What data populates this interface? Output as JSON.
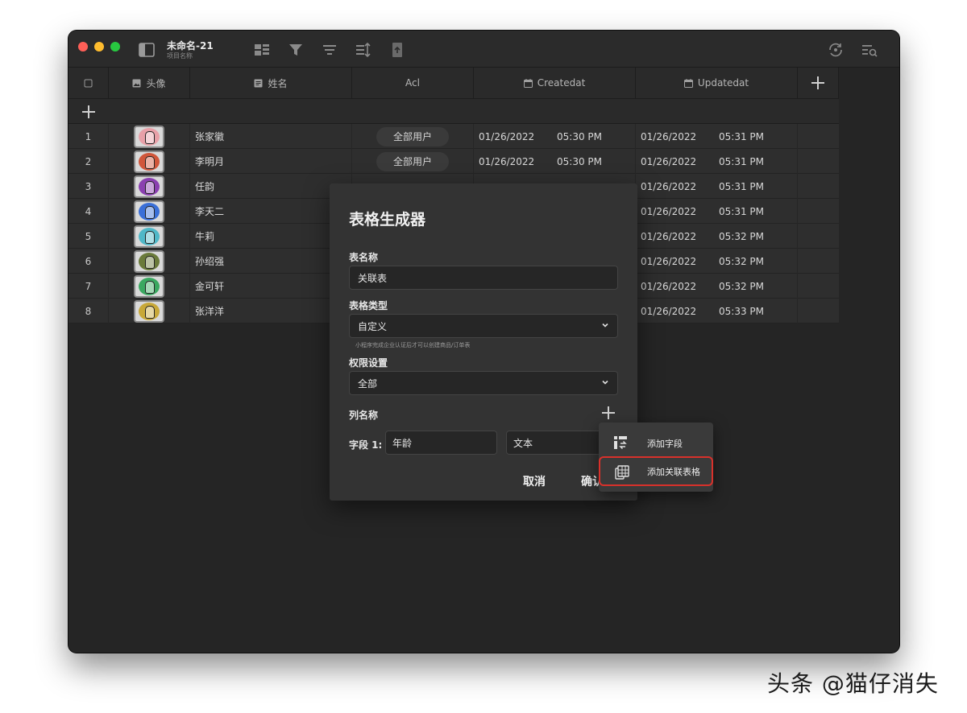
{
  "window": {
    "title": "未命名-21",
    "subtitle": "项目名称"
  },
  "columns": {
    "avatar": "头像",
    "name": "姓名",
    "acl": "Acl",
    "created": "Createdat",
    "updated": "Updatedat"
  },
  "rows": [
    {
      "num": "1",
      "name": "张家徽",
      "acl": "全部用户",
      "cdate": "01/26/2022",
      "ctime": "05:30 PM",
      "udate": "01/26/2022",
      "utime": "05:31 PM",
      "color": "#e8a0a8"
    },
    {
      "num": "2",
      "name": "李明月",
      "acl": "全部用户",
      "cdate": "01/26/2022",
      "ctime": "05:30 PM",
      "udate": "01/26/2022",
      "utime": "05:31 PM",
      "color": "#d0563a"
    },
    {
      "num": "3",
      "name": "任韵",
      "acl": "",
      "cdate": "",
      "ctime": "",
      "udate": "01/26/2022",
      "utime": "05:31 PM",
      "color": "#8a3fb0"
    },
    {
      "num": "4",
      "name": "李天二",
      "acl": "",
      "cdate": "",
      "ctime": "",
      "udate": "01/26/2022",
      "utime": "05:31 PM",
      "color": "#3a6fd8"
    },
    {
      "num": "5",
      "name": "牛莉",
      "acl": "",
      "cdate": "",
      "ctime": "",
      "udate": "01/26/2022",
      "utime": "05:32 PM",
      "color": "#4fb8c8"
    },
    {
      "num": "6",
      "name": "孙绍强",
      "acl": "",
      "cdate": "",
      "ctime": "",
      "udate": "01/26/2022",
      "utime": "05:32 PM",
      "color": "#6a7a3a"
    },
    {
      "num": "7",
      "name": "金可轩",
      "acl": "",
      "cdate": "",
      "ctime": "",
      "udate": "01/26/2022",
      "utime": "05:32 PM",
      "color": "#3aa860"
    },
    {
      "num": "8",
      "name": "张洋洋",
      "acl": "",
      "cdate": "",
      "ctime": "",
      "udate": "01/26/2022",
      "utime": "05:33 PM",
      "color": "#c8a838"
    }
  ],
  "dialog": {
    "title": "表格生成器",
    "table_name_label": "表名称",
    "table_name_value": "关联表",
    "table_type_label": "表格类型",
    "table_type_value": "自定义",
    "table_type_hint": "小程序完成企业认证后才可以创建商品/订单表",
    "permission_label": "权限设置",
    "permission_value": "全部",
    "columns_label": "列名称",
    "field1_label": "字段 1:",
    "field1_name": "年龄",
    "field1_type": "文本",
    "cancel": "取消",
    "confirm": "确认"
  },
  "menu": {
    "add_field": "添加字段",
    "add_relation_table": "添加关联表格"
  },
  "watermark": "头条 @猫仔消失"
}
